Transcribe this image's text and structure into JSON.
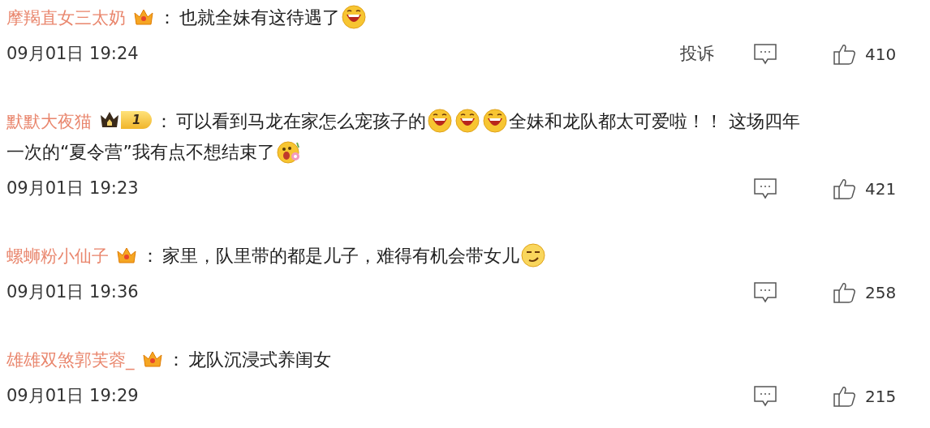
{
  "comments": [
    {
      "username": "摩羯直女三太奶",
      "badge": {
        "kind": "crown"
      },
      "separator": "：",
      "lines": [
        [
          {
            "kind": "text",
            "text": "也就全妹有这待遇了"
          },
          {
            "kind": "laugh"
          }
        ]
      ],
      "time": "09月01日 19:24",
      "report": "投诉",
      "likes": "410"
    },
    {
      "username": "默默大夜猫",
      "badge": {
        "kind": "level",
        "text": "1"
      },
      "separator": "：",
      "lines": [
        [
          {
            "kind": "text",
            "text": "可以看到马龙在家怎么宠孩子的"
          },
          {
            "kind": "laugh"
          },
          {
            "kind": "laugh"
          },
          {
            "kind": "laugh"
          },
          {
            "kind": "text",
            "text": "全妹和龙队都太可爱啦！！ 这场四年"
          }
        ],
        [
          {
            "kind": "text",
            "text": "一次的“夏令营”我有点不想结束了"
          },
          {
            "kind": "flower"
          }
        ]
      ],
      "time": "09月01日 19:23",
      "likes": "421"
    },
    {
      "username": "螺蛳粉小仙子",
      "badge": {
        "kind": "crown"
      },
      "separator": "：",
      "lines": [
        [
          {
            "kind": "text",
            "text": "家里，队里带的都是儿子，难得有机会带女儿"
          },
          {
            "kind": "smirk"
          }
        ]
      ],
      "time": "09月01日 19:36",
      "likes": "258"
    },
    {
      "username": "雄雄双煞郭芙蓉_",
      "badge": {
        "kind": "crown"
      },
      "separator": "：",
      "lines": [
        [
          {
            "kind": "text",
            "text": "龙队沉浸式养闺女"
          }
        ]
      ],
      "time": "09月01日 19:29",
      "likes": "215"
    }
  ]
}
